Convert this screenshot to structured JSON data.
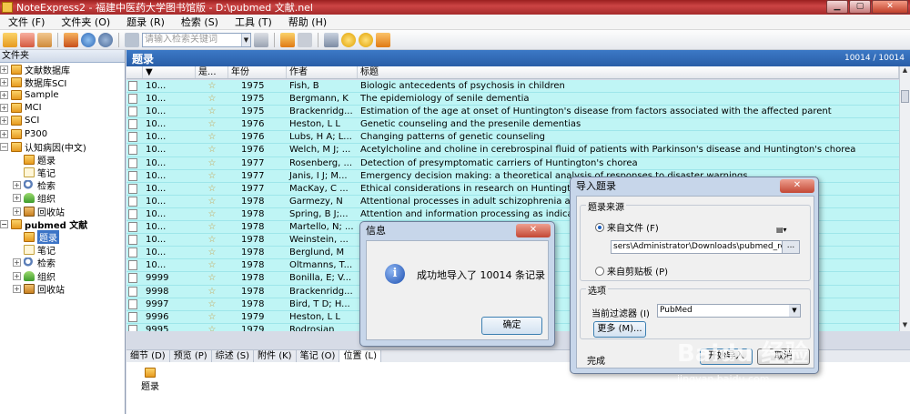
{
  "window": {
    "title": "NoteExpress2 - 福建中医药大学图书馆版 - D:\\pubmed 文献.nel"
  },
  "menu": [
    "文件 (F)",
    "文件夹 (O)",
    "题录 (R)",
    "检索 (S)",
    "工具 (T)",
    "帮助 (H)"
  ],
  "toolbar": {
    "search_placeholder": "请输入检索关键词"
  },
  "tree": {
    "header": "文件夹",
    "items": [
      {
        "label": "文献数据库",
        "level": 0,
        "icon": "database-icon"
      },
      {
        "label": "数据库SCI",
        "level": 0,
        "icon": "database-icon"
      },
      {
        "label": "Sample",
        "level": 0,
        "icon": "database-icon"
      },
      {
        "label": "MCI",
        "level": 0,
        "icon": "database-icon"
      },
      {
        "label": "SCI",
        "level": 0,
        "icon": "database-icon"
      },
      {
        "label": "P300",
        "level": 0,
        "icon": "database-icon"
      },
      {
        "label": "认知病因(中文)",
        "level": 0,
        "icon": "database-icon"
      },
      {
        "label": "题录",
        "level": 1,
        "icon": "database-icon"
      },
      {
        "label": "笔记",
        "level": 1,
        "icon": "note-icon"
      },
      {
        "label": "检索",
        "level": 1,
        "icon": "search-icon"
      },
      {
        "label": "组织",
        "level": 1,
        "icon": "organize-icon"
      },
      {
        "label": "回收站",
        "level": 1,
        "icon": "recycle-bin-icon"
      },
      {
        "label": "pubmed 文献",
        "level": 0,
        "icon": "database-icon"
      },
      {
        "label": "题录",
        "level": 1,
        "icon": "database-icon"
      },
      {
        "label": "笔记",
        "level": 1,
        "icon": "note-icon"
      },
      {
        "label": "检索",
        "level": 1,
        "icon": "search-icon"
      },
      {
        "label": "组织",
        "level": 1,
        "icon": "organize-icon"
      },
      {
        "label": "回收站",
        "level": 1,
        "icon": "recycle-bin-icon"
      }
    ]
  },
  "main": {
    "title": "题录",
    "count": "10014 / 10014",
    "columns": [
      "",
      "",
      "是...",
      "年份",
      "作者",
      "标题"
    ],
    "rows": [
      {
        "id": "10...",
        "year": "1975",
        "author": "Fish, B",
        "title": "Biologic antecedents of psychosis in children"
      },
      {
        "id": "10...",
        "year": "1975",
        "author": "Bergmann, K",
        "title": "The epidemiology of senile dementia"
      },
      {
        "id": "10...",
        "year": "1975",
        "author": "Brackenridg...",
        "title": "Estimation of the age at onset of Huntington's disease from factors associated with the affected parent"
      },
      {
        "id": "10...",
        "year": "1976",
        "author": "Heston, L L",
        "title": "Genetic counseling and the presenile dementias"
      },
      {
        "id": "10...",
        "year": "1976",
        "author": "Lubs, H A; L...",
        "title": "Changing patterns of genetic counseling"
      },
      {
        "id": "10...",
        "year": "1976",
        "author": "Welch, M J; ...",
        "title": "Acetylcholine and choline in cerebrospinal fluid of patients with Parkinson's disease and Huntington's chorea"
      },
      {
        "id": "10...",
        "year": "1977",
        "author": "Rosenberg, ...",
        "title": "Detection of presymptomatic carriers of Huntington's chorea"
      },
      {
        "id": "10...",
        "year": "1977",
        "author": "Janis, I J; M...",
        "title": "Emergency decision making: a theoretical analysis of responses to disaster warnings"
      },
      {
        "id": "10...",
        "year": "1977",
        "author": "MacKay, C ...",
        "title": "Ethical considerations in research on Huntington's d"
      },
      {
        "id": "10...",
        "year": "1978",
        "author": "Garmezy, N",
        "title": "Attentional processes in adult schizophrenia and in"
      },
      {
        "id": "10...",
        "year": "1978",
        "author": "Spring, B J;...",
        "title": "Attention and information processing as indicators o"
      },
      {
        "id": "10...",
        "year": "1978",
        "author": "Martello, N; ...",
        "title": ""
      },
      {
        "id": "10...",
        "year": "1978",
        "author": "Weinstein, ...",
        "title": ""
      },
      {
        "id": "10...",
        "year": "1978",
        "author": "Berglund, M",
        "title": ""
      },
      {
        "id": "10...",
        "year": "1978",
        "author": "Oltmanns, T...",
        "title": ""
      },
      {
        "id": "9999",
        "year": "1978",
        "author": "Bonilla, E; V...",
        "title": ""
      },
      {
        "id": "9998",
        "year": "1978",
        "author": "Brackenridg...",
        "title": ""
      },
      {
        "id": "9997",
        "year": "1978",
        "author": "Bird, T D; H...",
        "title": ""
      },
      {
        "id": "9996",
        "year": "1979",
        "author": "Heston, L L",
        "title": ""
      },
      {
        "id": "9995",
        "year": "1979",
        "author": "Rodrosian",
        "title": ""
      }
    ]
  },
  "tabs": [
    "细节 (D)",
    "预览 (P)",
    "综述 (S)",
    "附件 (K)",
    "笔记 (O)",
    "位置 (L)"
  ],
  "location_pane": {
    "label": "题录"
  },
  "message_box": {
    "title": "信息",
    "message": "成功地导入了 10014 条记录",
    "ok_label": "确定"
  },
  "import_dialog": {
    "title": "导入题录",
    "source_group": "题录来源",
    "from_file": "来自文件 (F)",
    "file_path": "sers\\Administrator\\Downloads\\pubmed_result.txt",
    "browse": "...",
    "from_clipboard": "来自剪贴板 (P)",
    "options_group": "选项",
    "filter_label": "当前过滤器 (I)",
    "filter_value": "PubMed",
    "more_label": "更多 (M)...",
    "status": "完成",
    "import_label": "开始导入",
    "cancel_label": "取消"
  },
  "watermark": {
    "main": "Baidu 经验",
    "sub": "jingyan.baidu.com"
  }
}
